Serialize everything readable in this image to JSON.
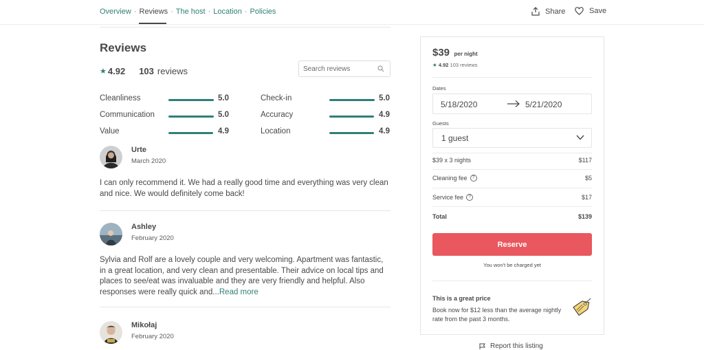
{
  "nav": {
    "links": [
      {
        "label": "Overview"
      },
      {
        "label": "Reviews"
      },
      {
        "label": "The host"
      },
      {
        "label": "Location"
      },
      {
        "label": "Policies"
      }
    ],
    "separator": "·",
    "share_label": "Share",
    "save_label": "Save"
  },
  "reviews": {
    "title": "Reviews",
    "star": "★",
    "score": "4.92",
    "count": "103",
    "count_word": "reviews",
    "search_placeholder": "Search reviews",
    "categories": [
      {
        "label": "Cleanliness",
        "value": "5.0",
        "fill": 1.0
      },
      {
        "label": "Check-in",
        "value": "5.0",
        "fill": 1.0
      },
      {
        "label": "Communication",
        "value": "5.0",
        "fill": 1.0
      },
      {
        "label": "Accuracy",
        "value": "4.9",
        "fill": 0.98
      },
      {
        "label": "Value",
        "value": "4.9",
        "fill": 0.98
      },
      {
        "label": "Location",
        "value": "4.9",
        "fill": 0.98
      }
    ],
    "items": [
      {
        "name": "Urte",
        "date": "March 2020",
        "text": "I can only recommend it. We had a really good time and everything was very clean and nice. We would definitely come back!"
      },
      {
        "name": "Ashley",
        "date": "February 2020",
        "text": "Sylvia and Rolf are a lovely couple and very welcoming. Apartment was fantastic, in a great location, and very clean and presentable. Their advice on local tips and places to see/eat was invaluable and they are very friendly and helpful. Also responses were really quick and...",
        "more": "Read more"
      },
      {
        "name": "Mikołaj",
        "date": "February 2020"
      }
    ]
  },
  "booking": {
    "price": "$39",
    "per_night": "per night",
    "star": "★",
    "score": "4.92",
    "reviews_count": "103 reviews",
    "dates_label": "Dates",
    "check_in": "5/18/2020",
    "check_out": "5/21/2020",
    "guests_label": "Guests",
    "guests_value": "1 guest",
    "lines": [
      {
        "label": "$39 x 3 nights",
        "amount": "$117"
      },
      {
        "label": "Cleaning fee",
        "amount": "$5",
        "help": "?"
      },
      {
        "label": "Service fee",
        "amount": "$17",
        "help": "?"
      }
    ],
    "total_label": "Total",
    "total_amount": "$139",
    "reserve_label": "Reserve",
    "no_charge": "You won't be charged yet",
    "promo_title": "This is a great price",
    "promo_text": "Book now for $12 less than the average nightly rate from the past 3 months."
  },
  "report_label": "Report this listing",
  "colors": {
    "accent": "#2f7f76",
    "reserve": "#e8585e",
    "text": "#484848"
  }
}
